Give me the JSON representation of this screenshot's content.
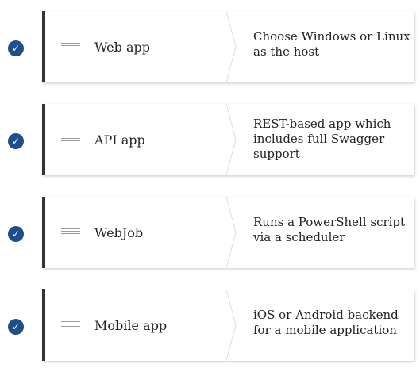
{
  "items": [
    {
      "label": "Web app",
      "description": "Choose Windows or Linux as the host",
      "checked": true
    },
    {
      "label": "API app",
      "description": "REST-based app which includes full Swagger support",
      "checked": true
    },
    {
      "label": "WebJob",
      "description": "Runs a PowerShell script via a scheduler",
      "checked": true
    },
    {
      "label": "Mobile app",
      "description": "iOS or Android backend for a mobile application",
      "checked": true
    }
  ],
  "colors": {
    "check_fill": "#1f4e8c",
    "card_border": "#333333",
    "text": "#222222"
  },
  "icons": {
    "check": "checkmark-circle-icon",
    "handle": "drag-handle-icon"
  }
}
